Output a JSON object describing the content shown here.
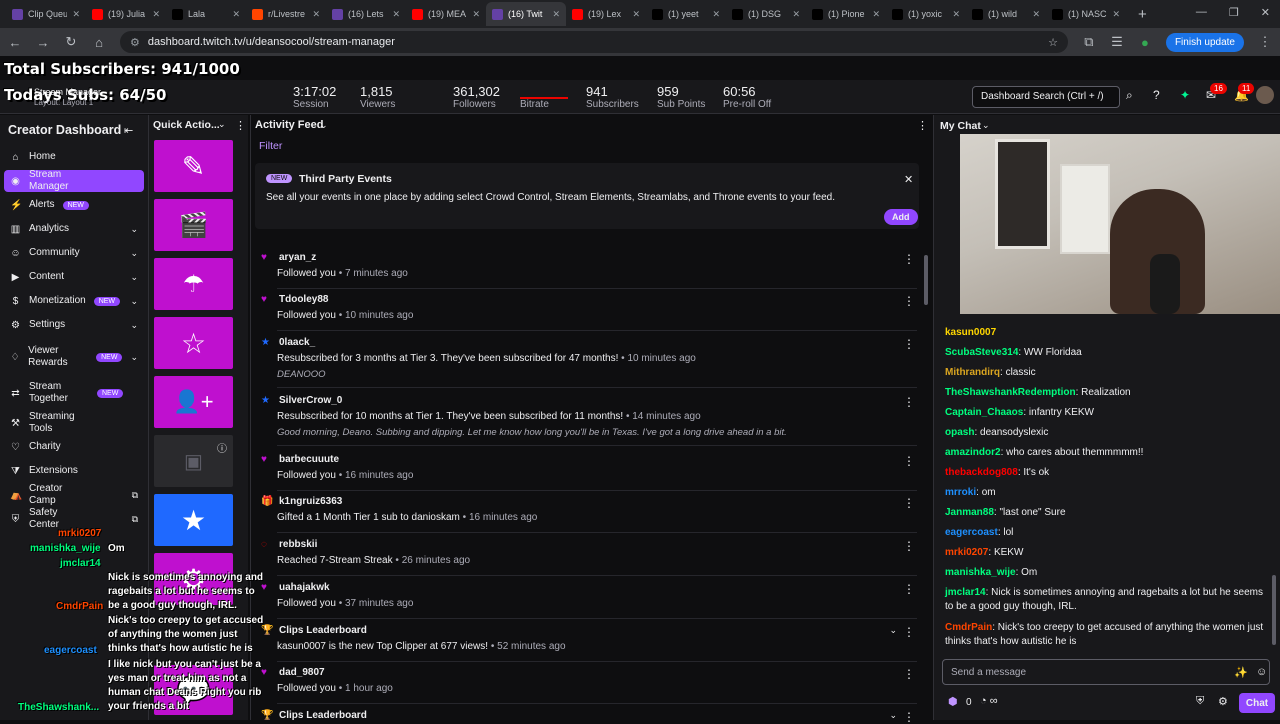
{
  "browser": {
    "tabs": [
      {
        "label": "Clip Queue",
        "color": "#6441a5"
      },
      {
        "label": "(19) Julia",
        "color": "#ff0000"
      },
      {
        "label": "Lala",
        "color": "#000000"
      },
      {
        "label": "r/Livestre",
        "color": "#ff4500"
      },
      {
        "label": "(16) Lets",
        "color": "#6441a5"
      },
      {
        "label": "(19) MEA",
        "color": "#ff0000"
      },
      {
        "label": "(16) Twit",
        "color": "#6441a5"
      },
      {
        "label": "(19) Lex",
        "color": "#ff0000"
      },
      {
        "label": "(1) yeet",
        "color": "#000000"
      },
      {
        "label": "(1) DSG",
        "color": "#000000"
      },
      {
        "label": "(1) Pione",
        "color": "#000000"
      },
      {
        "label": "(1) yoxic",
        "color": "#000000"
      },
      {
        "label": "(1) wild",
        "color": "#000000"
      },
      {
        "label": "(1) NASC",
        "color": "#000000"
      }
    ],
    "url": "dashboard.twitch.tv/u/deansocool/stream-manager",
    "finish_update": "Finish update"
  },
  "overlay": {
    "total_subs": "Total Subscribers: 941/1000",
    "todays_subs": "Todays Subs: 64/50",
    "stream_manager": "Stream Manager",
    "layout": "Layout: Layout 1"
  },
  "stats": [
    {
      "value": "3:17:02",
      "label": "Session"
    },
    {
      "value": "1,815",
      "label": "Viewers"
    },
    {
      "value": "361,302",
      "label": "Followers"
    },
    {
      "value": "",
      "label": "Bitrate"
    },
    {
      "value": "941",
      "label": "Subscribers"
    },
    {
      "value": "959",
      "label": "Sub Points"
    },
    {
      "value": "60:56",
      "label": "Pre-roll Off"
    }
  ],
  "header": {
    "search_placeholder": "Dashboard Search (Ctrl + /)",
    "notif_count": "16",
    "inbox_count": "11"
  },
  "sidebar": {
    "title": "Creator Dashboard",
    "items": [
      {
        "label": "Home",
        "icon": "home-icon",
        "badge": ""
      },
      {
        "label": "Stream Manager",
        "icon": "stream-icon",
        "badge": ""
      },
      {
        "label": "Alerts",
        "icon": "bolt-icon",
        "badge": "NEW"
      },
      {
        "label": "Analytics",
        "icon": "chart-icon",
        "badge": ""
      },
      {
        "label": "Community",
        "icon": "people-icon",
        "badge": ""
      },
      {
        "label": "Content",
        "icon": "video-icon",
        "badge": ""
      },
      {
        "label": "Monetization",
        "icon": "money-icon",
        "badge": "NEW"
      },
      {
        "label": "Settings",
        "icon": "gear-icon",
        "badge": ""
      },
      {
        "label": "Viewer Rewards",
        "icon": "reward-icon",
        "badge": "NEW"
      },
      {
        "label": "Stream Together",
        "icon": "together-icon",
        "badge": "NEW"
      },
      {
        "label": "Streaming Tools",
        "icon": "tools-icon",
        "badge": ""
      },
      {
        "label": "Charity",
        "icon": "heart-icon",
        "badge": ""
      },
      {
        "label": "Extensions",
        "icon": "puzzle-icon",
        "badge": ""
      },
      {
        "label": "Creator Camp",
        "icon": "camp-icon",
        "badge": ""
      },
      {
        "label": "Safety Center",
        "icon": "shield-icon",
        "badge": ""
      }
    ]
  },
  "quick_actions": {
    "title": "Quick Actio..."
  },
  "feed": {
    "title": "Activity Feed",
    "filter": "Filter",
    "third_party": {
      "badge": "NEW",
      "title": "Third Party Events",
      "desc": "See all your events in one place by adding select Crowd Control, Stream Elements, Streamlabs, and Throne events to your feed.",
      "add": "Add"
    },
    "events": [
      {
        "name": "aryan_z",
        "action": "Followed you",
        "time": "7 minutes ago",
        "icon": "heart-icon",
        "note": ""
      },
      {
        "name": "Tdooley88",
        "action": "Followed you",
        "time": "10 minutes ago",
        "icon": "heart-icon",
        "note": ""
      },
      {
        "name": "0laack_",
        "action": "Resubscribed for 3 months at Tier 3. They've been subscribed for 47 months!",
        "time": "10 minutes ago",
        "icon": "star-icon",
        "note": "DEANOOO"
      },
      {
        "name": "SilverCrow_0",
        "action": "Resubscribed for 10 months at Tier 1. They've been subscribed for 11 months!",
        "time": "14 minutes ago",
        "icon": "star-icon",
        "note": "Good morning, Deano. Subbing and dipping. Let me know how long you'll be in Texas. I've got a long drive ahead in a bit."
      },
      {
        "name": "barbecuuute",
        "action": "Followed you",
        "time": "16 minutes ago",
        "icon": "heart-icon",
        "note": ""
      },
      {
        "name": "k1ngruiz6363",
        "action": "Gifted a 1 Month Tier 1 sub to danioskam",
        "time": "16 minutes ago",
        "icon": "gift-icon",
        "note": ""
      },
      {
        "name": "rebbskii",
        "action": "Reached 7-Stream Streak",
        "time": "26 minutes ago",
        "icon": "streak-icon",
        "note": ""
      },
      {
        "name": "uahajakwk",
        "action": "Followed you",
        "time": "37 minutes ago",
        "icon": "heart-icon",
        "note": ""
      },
      {
        "name": "Clips Leaderboard",
        "action": "kasun0007 is the new Top Clipper at 677 views!",
        "time": "52 minutes ago",
        "icon": "trophy-icon",
        "note": ""
      },
      {
        "name": "dad_9807",
        "action": "Followed you",
        "time": "1 hour ago",
        "icon": "heart-icon",
        "note": ""
      },
      {
        "name": "Clips Leaderboard",
        "action": "",
        "time": "",
        "icon": "trophy-icon",
        "note": ""
      }
    ]
  },
  "chat": {
    "title": "My Chat",
    "messages": [
      {
        "user": "kasun0007",
        "text": "",
        "color": "#ffd700"
      },
      {
        "user": "ScubaSteve314",
        "text": "WW Floridaa",
        "color": "#00ff7f"
      },
      {
        "user": "Mithrandirq",
        "text": "classic",
        "color": "#daa520"
      },
      {
        "user": "TheShawshankRedemption",
        "text": "Realization",
        "color": "#00ff7f"
      },
      {
        "user": "Captain_Chaaos",
        "text": "infantry KEKW",
        "color": "#00ff7f"
      },
      {
        "user": "opash",
        "text": "deansodyslexic",
        "color": "#00ff7f"
      },
      {
        "user": "amazindor2",
        "text": "who cares about themmmmm!!",
        "color": "#00ff7f"
      },
      {
        "user": "thebackdog808",
        "text": "It's ok",
        "color": "#ff0000"
      },
      {
        "user": "mrroki",
        "text": "om",
        "color": "#1e90ff"
      },
      {
        "user": "Janman88",
        "text": "\"last one\" Sure",
        "color": "#00ff7f"
      },
      {
        "user": "eagercoast",
        "text": "lol",
        "color": "#1e90ff"
      },
      {
        "user": "mrki0207",
        "text": "KEKW",
        "color": "#ff4500"
      },
      {
        "user": "manishka_wije",
        "text": "Om",
        "color": "#00ff7f"
      },
      {
        "user": "jmclar14",
        "text": "Nick is sometimes annoying and ragebaits a lot but he seems to be a good guy though, IRL.",
        "color": "#00ff7f"
      },
      {
        "user": "CmdrPain",
        "text": "Nick's too creepy to get accused of anything the women just thinks that's how autistic he is",
        "color": "#ff4500"
      }
    ],
    "send_placeholder": "Send a message",
    "points": "0",
    "chat_button": "Chat"
  },
  "overlay_chat": [
    {
      "user": "mrki0207",
      "text": "",
      "color": "#ff4500"
    },
    {
      "user": "manishka_wije",
      "text": "Om",
      "color": "#00ff7f"
    },
    {
      "user": "jmclar14",
      "text": "Nick is sometimes annoying and ragebaits a lot but he seems to be a good guy though, IRL.",
      "color": "#00ff7f"
    },
    {
      "user": "CmdrPain",
      "text": "Nick's too creepy to get accused of anything the women just thinks that's how autistic he is",
      "color": "#ff4500"
    },
    {
      "user": "eagercoast",
      "text": "I like nick but you can't just be a yes man or treat him as not a human chat Deans Right you rib your friends a bit",
      "color": "#1e90ff"
    },
    {
      "user": "TheShawshank...",
      "text": "",
      "color": "#00ff7f"
    }
  ]
}
